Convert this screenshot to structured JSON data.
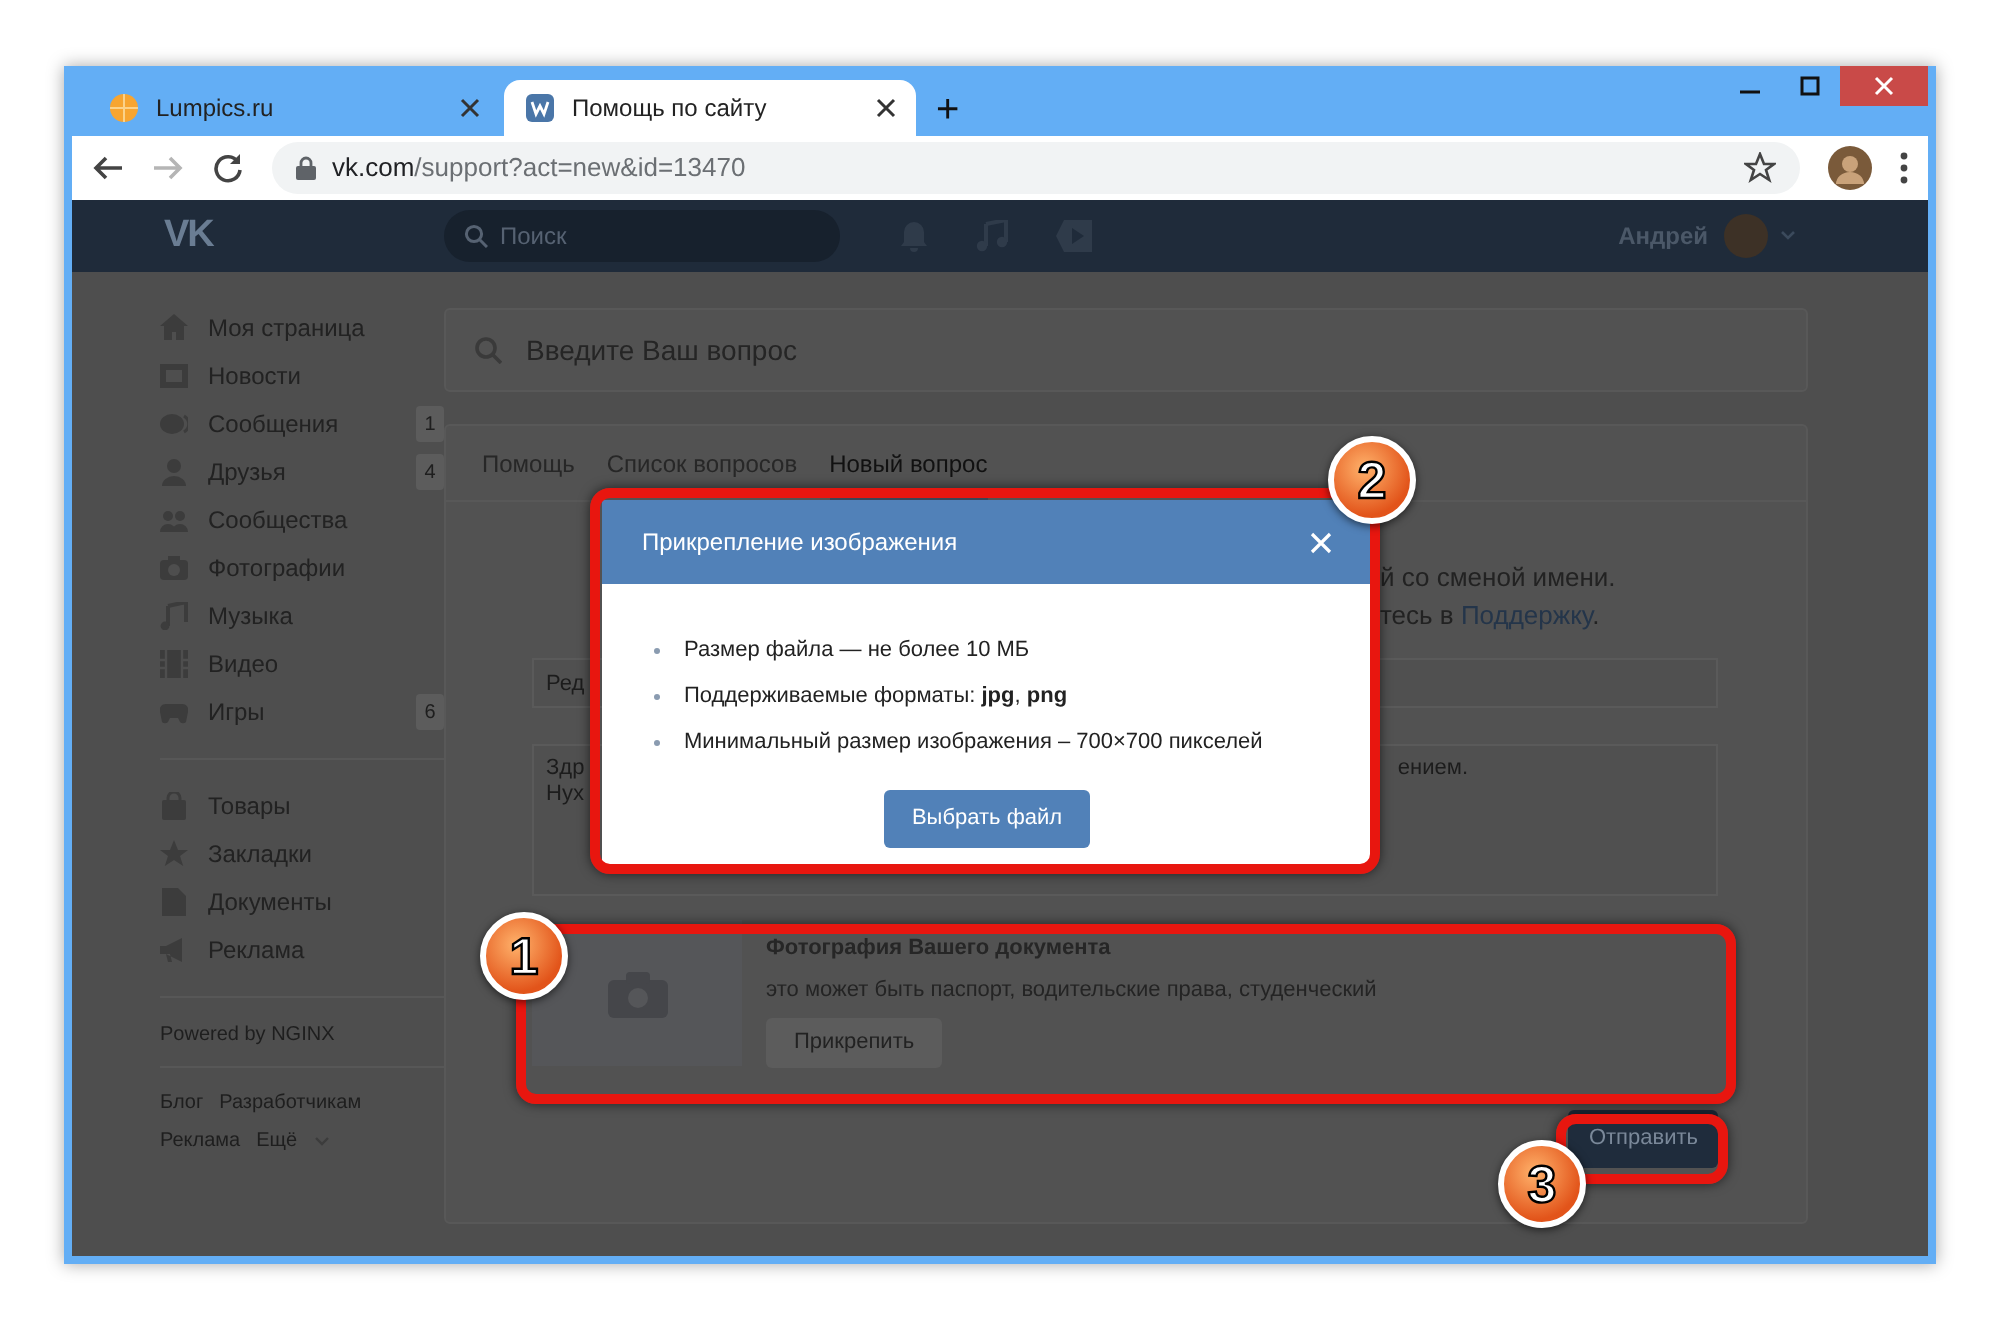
{
  "browser": {
    "tabs": [
      {
        "title": "Lumpics.ru",
        "selected": false
      },
      {
        "title": "Помощь по сайту",
        "selected": true
      }
    ],
    "new_tab": "+",
    "address": {
      "host": "vk.com",
      "path": "/support?act=new&id=13470"
    },
    "forward_disabled": true
  },
  "vk_header": {
    "logo": "VK",
    "search_placeholder": "Поиск",
    "user_name": "Андрей"
  },
  "sidebar": {
    "items": [
      {
        "label": "Моя страница"
      },
      {
        "label": "Новости"
      },
      {
        "label": "Сообщения",
        "badge": "1"
      },
      {
        "label": "Друзья",
        "badge": "4"
      },
      {
        "label": "Сообщества"
      },
      {
        "label": "Фотографии"
      },
      {
        "label": "Музыка"
      },
      {
        "label": "Видео"
      },
      {
        "label": "Игры",
        "badge": "6"
      },
      {
        "label": "Товары",
        "group_start": true
      },
      {
        "label": "Закладки"
      },
      {
        "label": "Документы"
      },
      {
        "label": "Реклама"
      }
    ],
    "powered": "Powered by NGINX",
    "footer_links": [
      [
        "Блог",
        "Разработчикам"
      ],
      [
        "Реклама",
        "Ещё"
      ]
    ]
  },
  "main": {
    "search_placeholder": "Введите Ваш вопрос",
    "tabs": [
      {
        "label": "Помощь",
        "selected": false
      },
      {
        "label": "Список вопросов",
        "selected": false
      },
      {
        "label": "Новый вопрос",
        "selected": true
      }
    ],
    "intro_lines": [
      {
        "text": "й со сменой имени."
      },
      {
        "text": "тесь в ",
        "link": "Поддержку",
        "tail": "."
      }
    ],
    "title_field_value": "Ред",
    "textarea": {
      "left_lines": [
        "Здр",
        "Нух"
      ],
      "right_fragment": "ением."
    },
    "upload": {
      "title": "Фотография Вашего документа",
      "subtitle": "это может быть паспорт, водительские права, студенческий",
      "button": "Прикрепить"
    },
    "submit": "Отправить"
  },
  "modal": {
    "title": "Прикрепление изображения",
    "items": [
      "Размер файла — не более 10 МБ",
      "Поддерживаемые форматы: **jpg**, **png**",
      "Минимальный размер изображения – 700×700 пикселей"
    ],
    "button": "Выбрать файл"
  },
  "callouts": [
    {
      "number": "1"
    },
    {
      "number": "2"
    },
    {
      "number": "3"
    }
  ]
}
